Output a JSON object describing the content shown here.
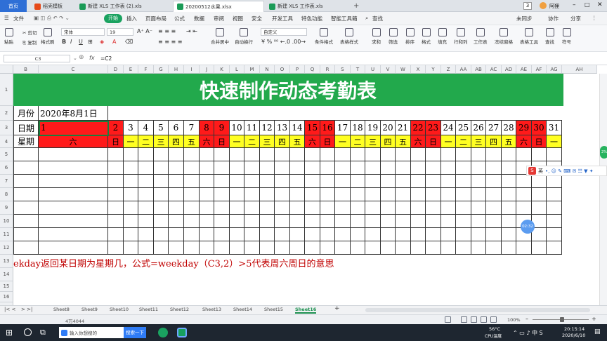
{
  "tabs": [
    {
      "label": "首页",
      "active": false,
      "home": true
    },
    {
      "label": "稻壳模板",
      "active": false,
      "icon_color": "#e64a19"
    },
    {
      "label": "新建 XLS 工作表 (2).xls",
      "active": false,
      "icon_color": "#1a9b57"
    },
    {
      "label": "20200512水果.xlsx",
      "active": true,
      "icon_color": "#1a9b57"
    },
    {
      "label": "新建 XLS 工作表.xls",
      "active": false,
      "icon_color": "#1a9b57"
    }
  ],
  "titlebar": {
    "badge": "3",
    "user": "阿狸"
  },
  "menu": {
    "file": "文件",
    "items": [
      "开始",
      "插入",
      "页面布局",
      "公式",
      "数据",
      "审阅",
      "视图",
      "安全",
      "开发工具",
      "特色功能",
      "智能工具箱"
    ],
    "search": "查找",
    "right": [
      "未同步",
      "协作",
      "分享"
    ]
  },
  "ribbon": {
    "cut": "剪切",
    "copy": "复制",
    "paste": "粘贴",
    "format_painter": "格式刷",
    "font_name": "宋体",
    "font_size": "19",
    "merge": "合并居中",
    "wrap": "自动换行",
    "number_format": "自定义",
    "cond_format": "条件格式",
    "table_style": "表格样式",
    "sum": "求和",
    "filter": "筛选",
    "sort": "排序",
    "format": "格式",
    "fill": "填充",
    "rowcol": "行和列",
    "worksheet": "工作表",
    "freeze": "冻结窗格",
    "table_tools": "表格工具",
    "find": "查找",
    "symbol": "符号"
  },
  "formula_bar": {
    "cell_ref": "C3",
    "fx": "fx",
    "formula": "=C2"
  },
  "columns": [
    "B",
    "C",
    "D",
    "E",
    "F",
    "G",
    "H",
    "I",
    "J",
    "K",
    "L",
    "M",
    "N",
    "O",
    "P",
    "Q",
    "R",
    "S",
    "T",
    "U",
    "V",
    "W",
    "X",
    "Y",
    "Z",
    "AA",
    "AB",
    "AC",
    "AD",
    "AE",
    "AF",
    "AG",
    "AH"
  ],
  "rows": [
    "1",
    "2",
    "3",
    "4",
    "5",
    "6",
    "7",
    "8",
    "9",
    "10",
    "11",
    "12",
    "13",
    "14",
    "15",
    "16",
    "17"
  ],
  "sheet": {
    "title": "快速制作动态考勤表",
    "month_label": "月份",
    "month_value": "2020年8月1日",
    "date_label": "日期",
    "weekday_label": "星期",
    "dates": [
      "1",
      "2",
      "3",
      "4",
      "5",
      "6",
      "7",
      "8",
      "9",
      "10",
      "11",
      "12",
      "13",
      "14",
      "15",
      "16",
      "17",
      "18",
      "19",
      "20",
      "21",
      "22",
      "23",
      "24",
      "25",
      "26",
      "27",
      "28",
      "29",
      "30",
      "31"
    ],
    "weekdays": [
      "六",
      "日",
      "一",
      "二",
      "三",
      "四",
      "五",
      "六",
      "日",
      "一",
      "二",
      "三",
      "四",
      "五",
      "六",
      "日",
      "一",
      "二",
      "三",
      "四",
      "五",
      "六",
      "日",
      "一",
      "二",
      "三",
      "四",
      "五",
      "六",
      "日",
      "一"
    ],
    "note": "ekday返回某日期为星期几，公式=weekday（C3,2）>5代表周六周日的意思"
  },
  "colors": {
    "title_bg": "#22a94c",
    "weekend": "#ff1a1a",
    "weekday_fill": "#ffff22",
    "accent": "#1aa260",
    "note": "#c00000"
  },
  "sheet_tabs": [
    "Sheet8",
    "Sheet9",
    "Sheet10",
    "Sheet11",
    "Sheet12",
    "Sheet13",
    "Sheet14",
    "Sheet15",
    "Sheet16"
  ],
  "active_sheet": "Sheet16",
  "status": {
    "count": "4万4044",
    "zoom": "100%"
  },
  "floating": {
    "timer": "02:32",
    "ime_label": "英",
    "side_badge": "2%"
  },
  "taskbar": {
    "search_placeholder": "输入你想搜的",
    "search_button": "搜索一下",
    "temp": "56°C",
    "temp_label": "CPU温度",
    "time": "20:15:14",
    "date": "2020/6/10"
  }
}
